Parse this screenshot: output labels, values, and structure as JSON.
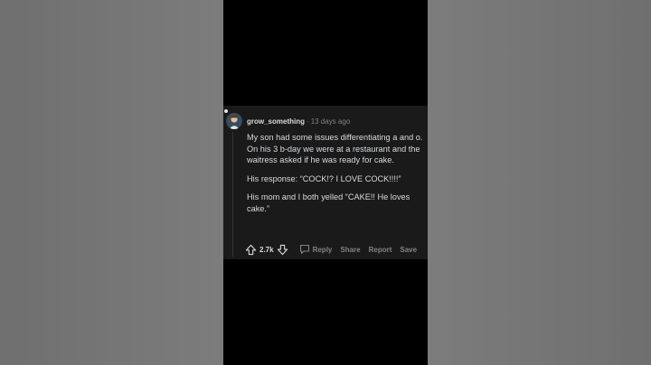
{
  "comment": {
    "username": "grow_something",
    "separator": "·",
    "timestamp": "13 days ago",
    "paragraphs": [
      "My son had some issues differentiating a and o. On his 3 b-day we were at a restaurant and the waitress asked if he was ready for cake.",
      "His response: “COCK!? I LOVE COCK!!!!”",
      "His mom and I both yelled “CAKE!! He loves cake.”"
    ],
    "score": "2.7k"
  },
  "actions": {
    "reply": "Reply",
    "share": "Share",
    "report": "Report",
    "save": "Save"
  },
  "icons": {
    "upvote": "arrow-up-icon",
    "downvote": "arrow-down-icon",
    "reply": "speech-bubble-icon"
  },
  "colors": {
    "card_background": "#1a1a1b",
    "text_primary": "#d7dadc",
    "text_muted": "#818384"
  }
}
